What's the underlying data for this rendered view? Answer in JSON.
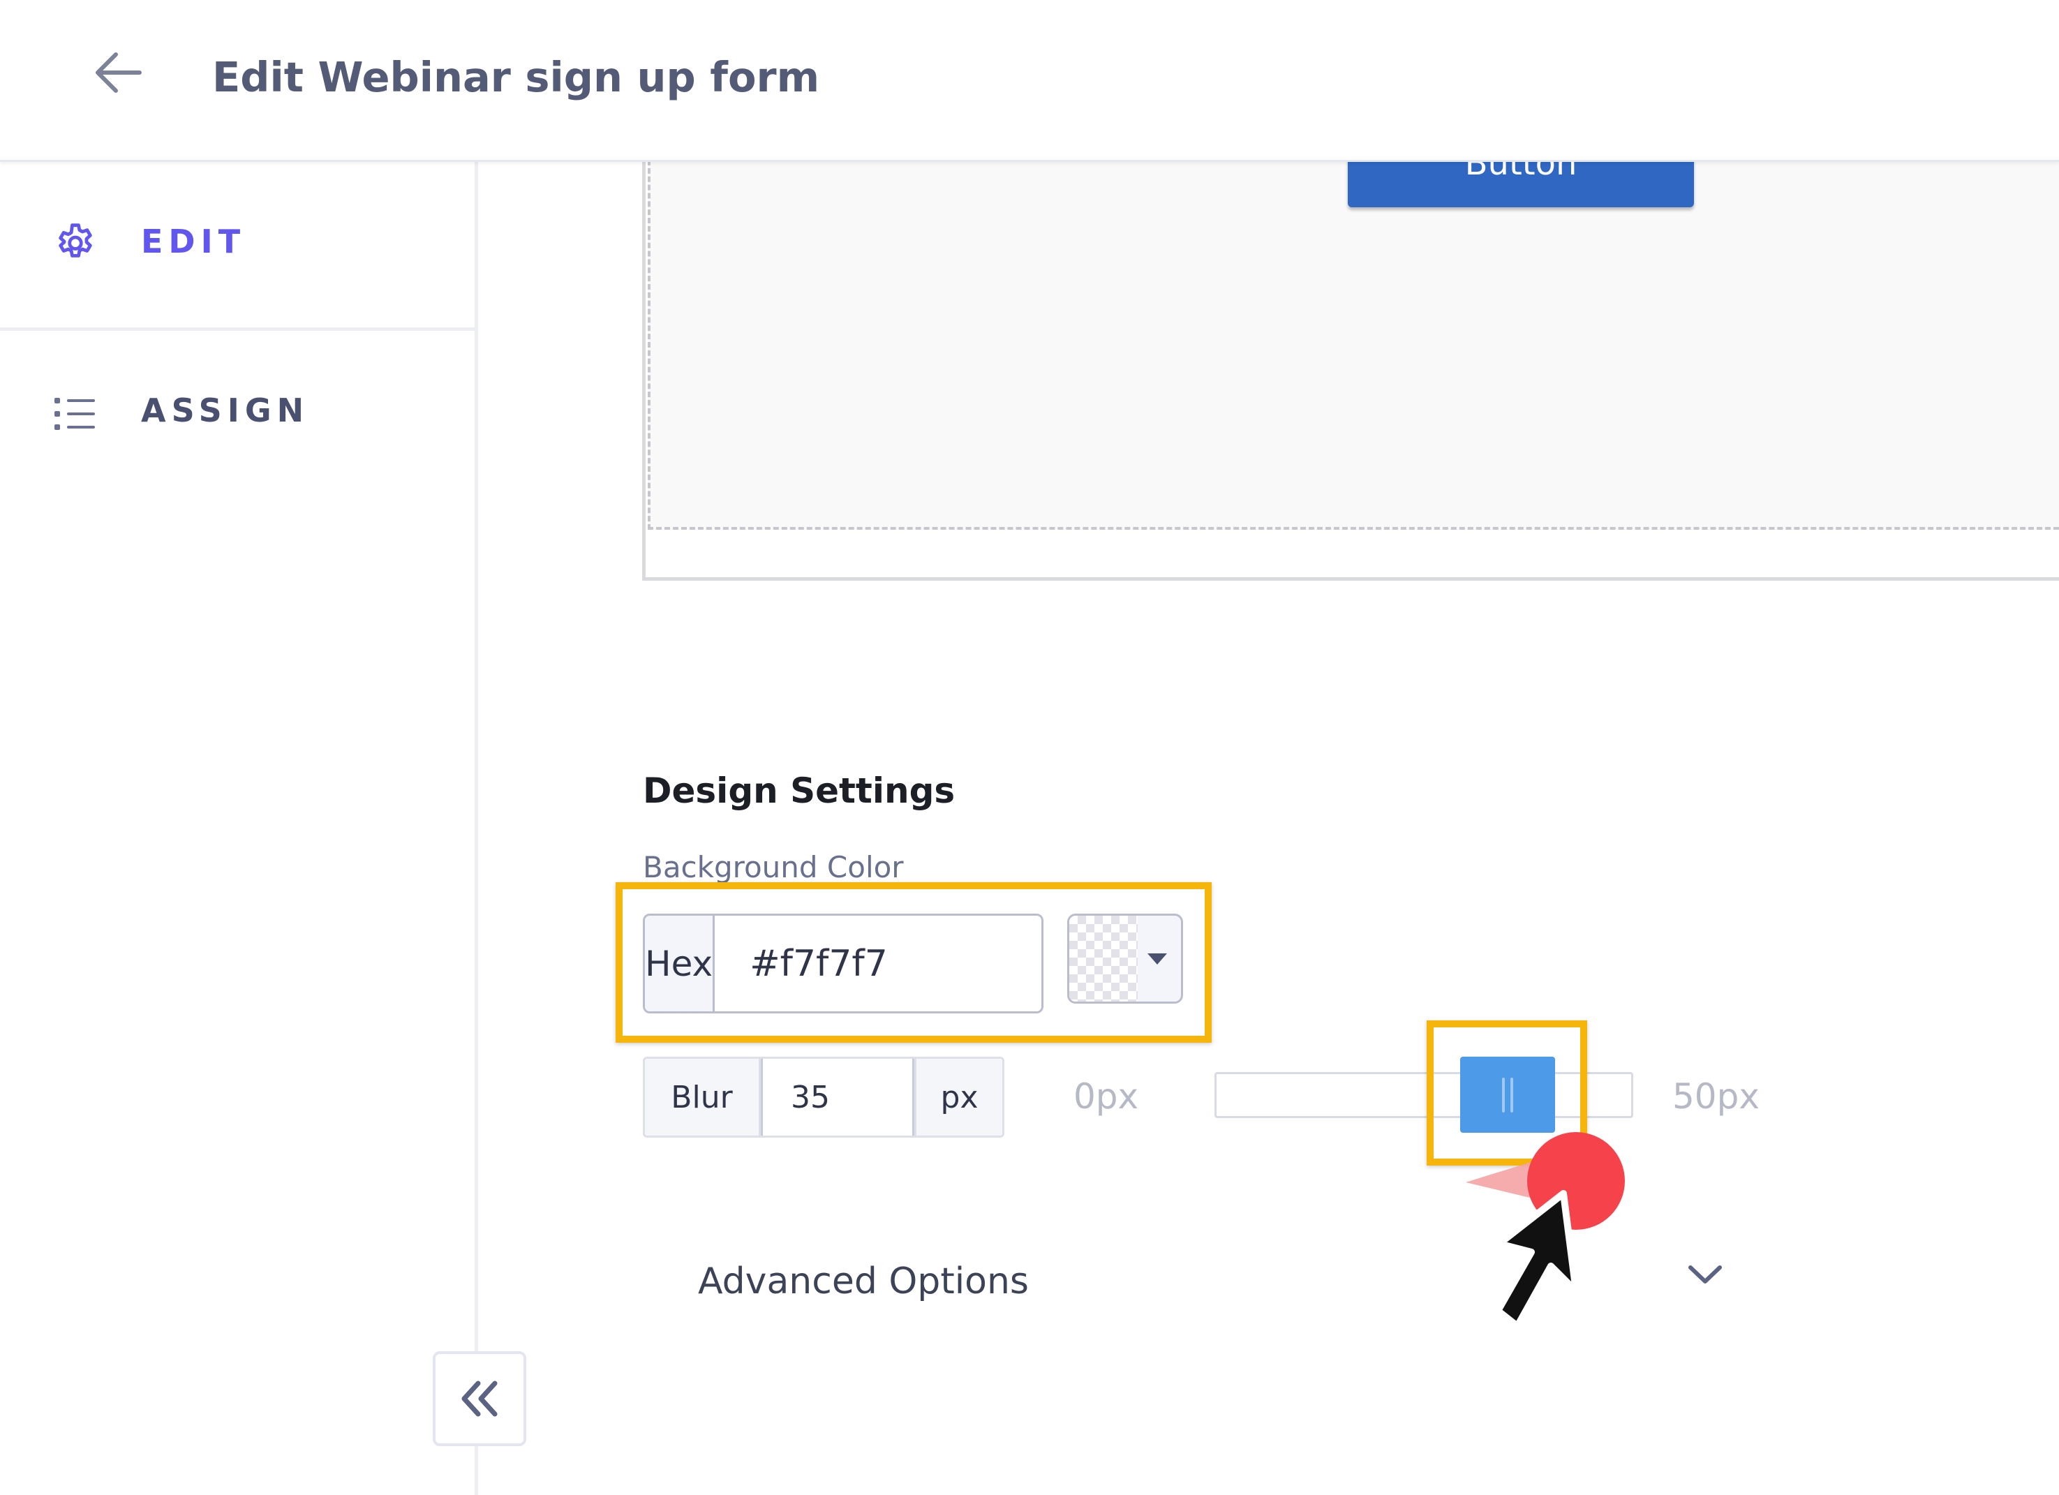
{
  "header": {
    "title": "Edit Webinar sign up form",
    "back_icon": "arrow-left-icon"
  },
  "sidebar": {
    "items": [
      {
        "label": "EDIT",
        "icon": "gear-icon",
        "active": true,
        "color": "#6157ee"
      },
      {
        "label": "ASSIGN",
        "icon": "list-icon",
        "active": false,
        "color": "#4a5170"
      }
    ],
    "collapse_icon": "double-chevron-left-icon"
  },
  "canvas": {
    "button_label": "Button",
    "button_color": "#2f67c2",
    "background": "#f9f9f9"
  },
  "design_settings": {
    "title": "Design Settings",
    "background_color_label": "Background Color",
    "hex_addon": "Hex",
    "hex_value": "#f7f7f7",
    "blur_label": "Blur",
    "blur_value": "35",
    "blur_unit": "px",
    "range_min": "0px",
    "range_max": "50px",
    "slider_value_fraction": 0.7,
    "slider_color": "#4d9ae8",
    "highlight_color": "#f5b50a"
  },
  "advanced_options": {
    "label": "Advanced Options",
    "icon": "chevron-down-icon"
  },
  "cursor": {
    "icon": "mouse-pointer-icon",
    "click_indicator_color": "#f5424b"
  }
}
